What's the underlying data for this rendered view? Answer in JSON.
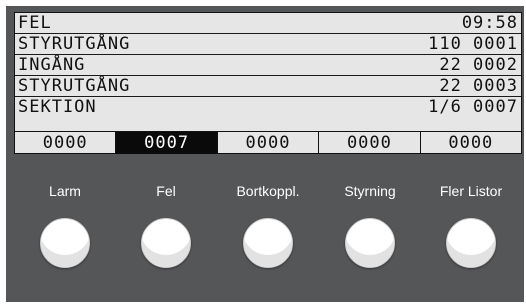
{
  "display": {
    "header": {
      "left": "FEL",
      "right": "09:58"
    },
    "rows": [
      {
        "label": "STYRUTGÅNG",
        "value": "110 0001"
      },
      {
        "label": "INGÅNG",
        "value": "22 0002"
      },
      {
        "label": "STYRUTGÅNG",
        "value": "22 0003"
      },
      {
        "label": "SEKTION",
        "value": "1/6 0007"
      }
    ],
    "cells": [
      {
        "text": "0000",
        "active": false
      },
      {
        "text": "0007",
        "active": true
      },
      {
        "text": "0000",
        "active": false
      },
      {
        "text": "0000",
        "active": false
      },
      {
        "text": "0000",
        "active": false
      }
    ]
  },
  "buttons": [
    {
      "label": "Larm"
    },
    {
      "label": "Fel"
    },
    {
      "label": "Bortkoppl."
    },
    {
      "label": "Styrning"
    },
    {
      "label": "Fler Listor"
    }
  ],
  "colors": {
    "bezel": "#555658",
    "lcd_background": "#e6e6e6",
    "active_cell": "#0a0a0a"
  }
}
